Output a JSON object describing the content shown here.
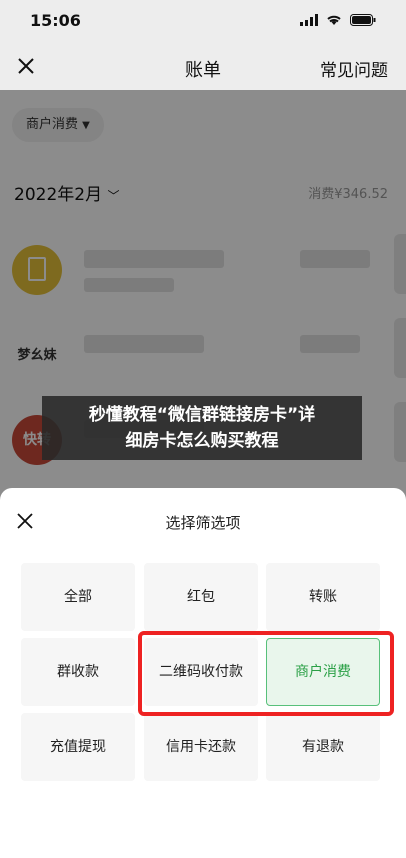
{
  "status": {
    "time": "15:06"
  },
  "nav": {
    "title": "账单",
    "right_link": "常见问题"
  },
  "filter_pill": {
    "label": "商户消费",
    "icon": "caret-down-icon"
  },
  "month_row": {
    "label": "2022年2月",
    "total": "消费¥346.52"
  },
  "banner": {
    "line1": "秒懂教程“微信群链接房卡”详",
    "line2": "细房卡怎么购买教程"
  },
  "logos": {
    "row2": "梦幺妹",
    "row3": "快转"
  },
  "sheet": {
    "title": "选择筛选项",
    "options": [
      {
        "label": "全部"
      },
      {
        "label": "红包"
      },
      {
        "label": "转账"
      },
      {
        "label": "群收款"
      },
      {
        "label": "二维码收付款"
      },
      {
        "label": "商户消费"
      },
      {
        "label": "充值提现"
      },
      {
        "label": "信用卡还款"
      },
      {
        "label": "有退款"
      }
    ],
    "selected_index": 5
  },
  "colors": {
    "accent": "#2aa046",
    "highlight_box": "#ee2222"
  }
}
